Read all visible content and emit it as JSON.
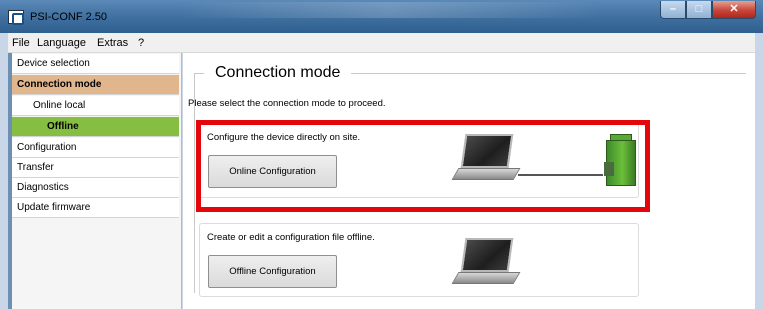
{
  "window": {
    "title": "PSI-CONF 2.50"
  },
  "menu": {
    "items": [
      "File",
      "Language",
      "Extras",
      "?"
    ]
  },
  "sidebar": {
    "items": [
      {
        "label": "Device selection"
      },
      {
        "label": "Connection mode"
      },
      {
        "label": "Online local"
      },
      {
        "label": "Offline"
      },
      {
        "label": "Configuration"
      },
      {
        "label": "Transfer"
      },
      {
        "label": "Diagnostics"
      },
      {
        "label": "Update firmware"
      }
    ]
  },
  "main": {
    "title": "Connection mode",
    "intro": "Please select the connection mode to proceed.",
    "online_card": {
      "description": "Configure the device directly on site.",
      "button": "Online Configuration"
    },
    "offline_card": {
      "description": "Create or edit a configuration file offline.",
      "button": "Offline Configuration"
    }
  },
  "colors": {
    "highlight": "#e3060b",
    "active_section": "#e2b68d",
    "active_page": "#85be41"
  }
}
